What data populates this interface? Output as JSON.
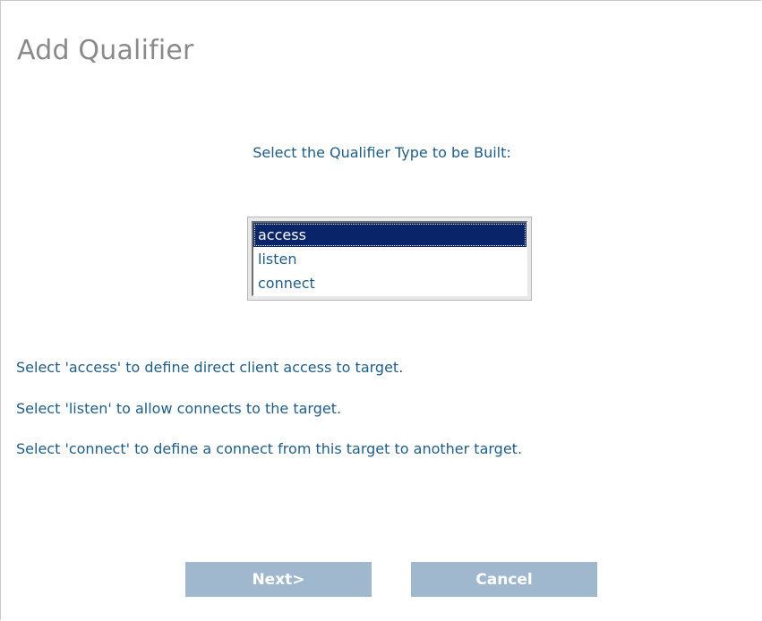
{
  "dialog": {
    "title": "Add Qualifier",
    "prompt": "Select the Qualifier Type to be Built:"
  },
  "qualifier_types": {
    "selected": "access",
    "options": [
      "access",
      "listen",
      "connect"
    ]
  },
  "help": {
    "access": "Select 'access' to define direct client access to target.",
    "listen": "Select 'listen' to allow connects to the target.",
    "connect": "Select 'connect' to define a connect from this target to another target."
  },
  "buttons": {
    "next_label": "Next>",
    "cancel_label": "Cancel"
  },
  "colors": {
    "text": "#1f5d86",
    "title": "#8a8a8a",
    "selection": "#0a246a",
    "button": "#9fb8cd"
  }
}
